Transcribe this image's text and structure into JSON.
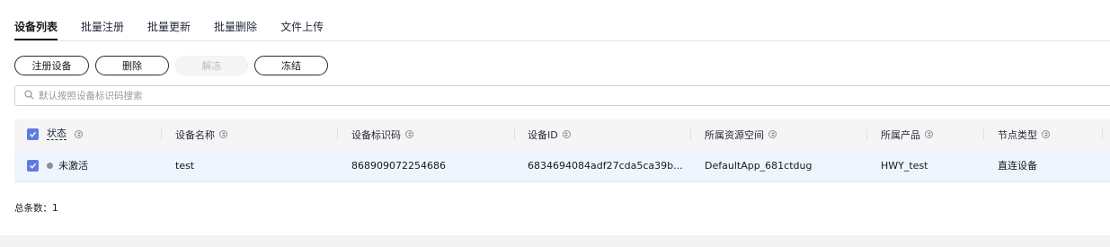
{
  "tabs": [
    "设备列表",
    "批量注册",
    "批量更新",
    "批量删除",
    "文件上传"
  ],
  "toolbar": {
    "register": "注册设备",
    "delete": "删除",
    "unfreeze": "解冻",
    "freeze": "冻结"
  },
  "search": {
    "placeholder": "默认按照设备标识码搜索"
  },
  "table": {
    "headers": [
      "状态",
      "设备名称",
      "设备标识码",
      "设备ID",
      "所属资源空间",
      "所属产品",
      "节点类型"
    ],
    "rows": [
      {
        "status": "未激活",
        "name": "test",
        "node_id": "868909072254686",
        "device_id": "6834694084adf27cda5ca39b...",
        "space": "DefaultApp_681ctdug",
        "product": "HWY_test",
        "node_type": "直连设备"
      }
    ]
  },
  "total": "总条数：1",
  "colors": {
    "accent": "#5e7ce0",
    "link": "#526ecc",
    "row_selected": "#eff5fe"
  }
}
